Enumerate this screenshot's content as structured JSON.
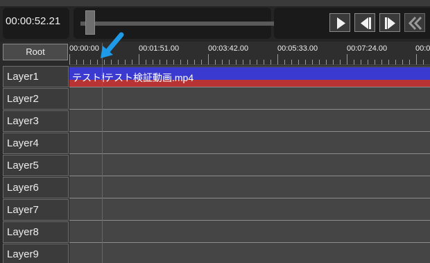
{
  "transport": {
    "time": "00:00:52.21",
    "scrub_value": 0.02,
    "buttons": [
      "play-icon",
      "step-back-icon",
      "step-forward-icon",
      "rewind-icon"
    ]
  },
  "header": {
    "root_label": "Root",
    "ticks": [
      "00:00:00",
      "00:01:51.00",
      "00:03:42.00",
      "00:05:33.00",
      "00:07:24.00",
      "00:0"
    ]
  },
  "layers": [
    "Layer1",
    "Layer2",
    "Layer3",
    "Layer4",
    "Layer5",
    "Layer6",
    "Layer7",
    "Layer8",
    "Layer9"
  ],
  "clip": {
    "label_prefix": "テスト検",
    "label": "テスト検証動画.mp4"
  },
  "colors": {
    "clip_blue": "#3a3ad0",
    "clip_red": "#b83333",
    "playhead": "#d23a3a",
    "pointer": "#1e9be8"
  }
}
